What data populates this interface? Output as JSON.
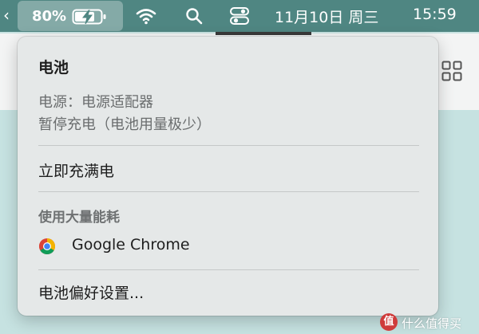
{
  "menubar": {
    "battery_percent": "80%",
    "date": "11月10日 周三",
    "time": "15:59",
    "icons": [
      "chevron-icon",
      "battery-charging-icon",
      "wifi-icon",
      "search-icon",
      "control-center-icon"
    ]
  },
  "battery_menu": {
    "title": "电池",
    "power_source": "电源：电源适配器",
    "charging_status": "暂停充电（电池用量极少）",
    "charge_now": "立即充满电",
    "significant_energy_heading": "使用大量能耗",
    "apps": [
      {
        "name": "Google Chrome",
        "icon": "chrome-icon"
      }
    ],
    "preferences": "电池偏好设置..."
  },
  "watermark": {
    "badge": "值",
    "text": "什么值得买"
  },
  "colors": {
    "menubar_bg": "#4f8682",
    "panel_bg": "#e5e8e8",
    "desktop_bg": "#c6e2e1"
  }
}
